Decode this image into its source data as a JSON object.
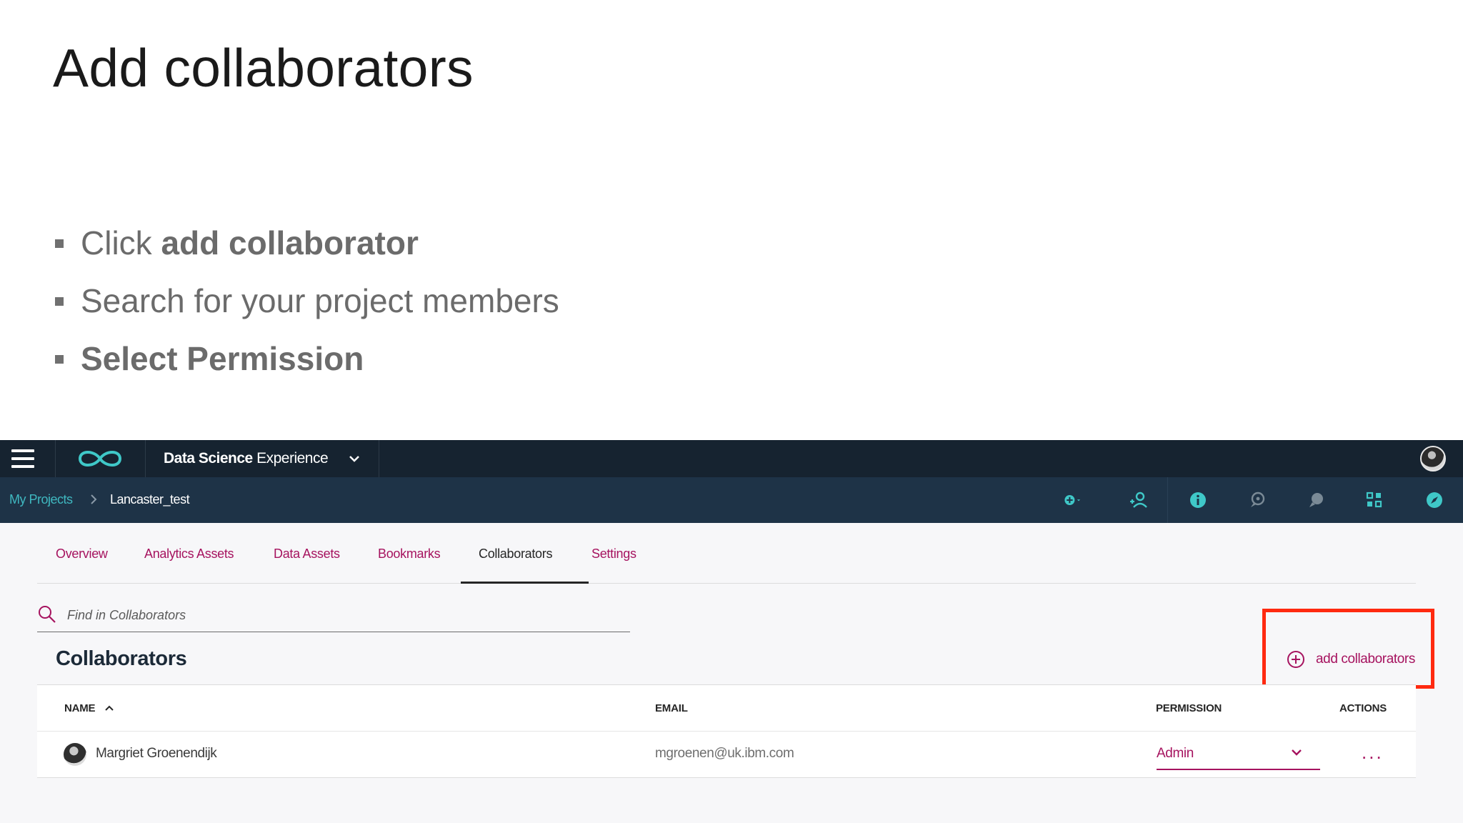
{
  "slide": {
    "title": "Add collaborators",
    "bullets": [
      {
        "prefix": "Click ",
        "bold": "add collaborator",
        "rest": ""
      },
      {
        "prefix": "Search for your project members",
        "bold": "",
        "rest": ""
      },
      {
        "prefix": "",
        "bold": "Select Permission",
        "rest": ""
      }
    ]
  },
  "app": {
    "name_bold": "Data Science",
    "name_rest": " Experience",
    "breadcrumb": {
      "parent": "My Projects",
      "current": "Lancaster_test"
    },
    "toolbar_icons": [
      "add-icon",
      "add-collaborator-icon",
      "info-icon",
      "comments-icon",
      "chat-icon",
      "grid-icon",
      "compass-icon"
    ],
    "tabs": [
      {
        "label": "Overview",
        "active": false
      },
      {
        "label": "Analytics Assets",
        "active": false
      },
      {
        "label": "Data Assets",
        "active": false
      },
      {
        "label": "Bookmarks",
        "active": false
      },
      {
        "label": "Collaborators",
        "active": true
      },
      {
        "label": "Settings",
        "active": false
      }
    ],
    "search": {
      "placeholder": "Find in Collaborators"
    },
    "section_title": "Collaborators",
    "add_button_label": "add collaborators",
    "table": {
      "headers": {
        "name": "NAME",
        "email": "EMAIL",
        "permission": "PERMISSION",
        "actions": "ACTIONS"
      },
      "rows": [
        {
          "name": "Margriet Groenendijk",
          "email": "mgroenen@uk.ibm.com",
          "permission": "Admin",
          "actions": "..."
        }
      ]
    }
  },
  "colors": {
    "accent": "#a6135f",
    "teal": "#3fb8c0",
    "topbar": "#162330",
    "projectbar": "#1e3347",
    "highlight": "#ff2a10"
  }
}
